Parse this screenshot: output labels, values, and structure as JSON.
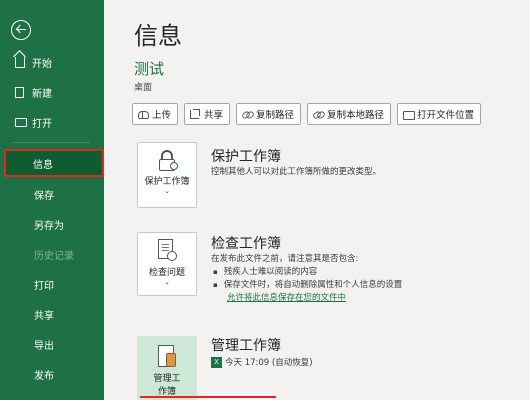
{
  "sidebar": {
    "items": [
      {
        "label": "开始"
      },
      {
        "label": "新建"
      },
      {
        "label": "打开"
      },
      {
        "label": "信息"
      },
      {
        "label": "保存"
      },
      {
        "label": "另存为"
      },
      {
        "label": "历史记录"
      },
      {
        "label": "打印"
      },
      {
        "label": "共享"
      },
      {
        "label": "导出"
      },
      {
        "label": "发布"
      }
    ]
  },
  "main": {
    "title": "信息",
    "file_name": "测试",
    "file_path": "桌面",
    "actions": [
      {
        "label": "上传",
        "icon": "upload-icon"
      },
      {
        "label": "共享",
        "icon": "share-icon"
      },
      {
        "label": "复制路径",
        "icon": "link-icon"
      },
      {
        "label": "复制本地路径",
        "icon": "link-icon"
      },
      {
        "label": "打开文件位置",
        "icon": "folder-icon"
      }
    ],
    "protect": {
      "button_label": "保护工作簿",
      "title": "保护工作簿",
      "desc": "控制其他人可以对此工作簿所做的更改类型。"
    },
    "inspect": {
      "button_label": "检查问题",
      "title": "检查工作簿",
      "desc": "在发布此文件之前，请注意其是否包含:",
      "bullets": [
        "残疾人士难以阅读的内容",
        "保存文件时，将自动删除属性和个人信息的设置"
      ],
      "link": "允许将此信息保存在您的文件中"
    },
    "manage": {
      "button_label_1": "管理工",
      "button_label_2": "作簿",
      "title": "管理工作簿",
      "version": "今天 17:09 (自动恢复)"
    }
  },
  "colors": {
    "sidebar": "#1e7145",
    "accent": "#1e7145",
    "highlight": "#e0281c"
  }
}
